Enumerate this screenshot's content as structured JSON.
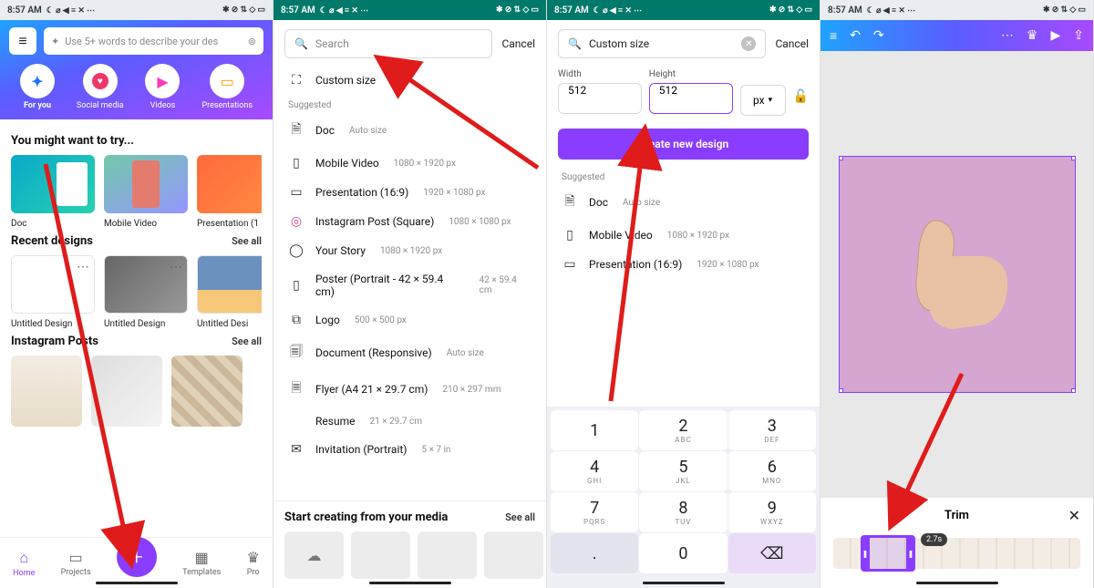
{
  "status": {
    "time": "8:57 AM",
    "icons_left": [
      "☾",
      "⌀",
      "◀",
      "≡",
      "✕",
      "⋯"
    ],
    "icons_right": [
      "✱",
      "⊘",
      "⇅",
      "◇",
      "▯68"
    ]
  },
  "screen1": {
    "search_placeholder": "Use 5+ words to describe your des",
    "cats": [
      {
        "label": "For you",
        "color": "c-star",
        "glyph": "✦"
      },
      {
        "label": "Social media",
        "color": "",
        "glyph": "♥"
      },
      {
        "label": "Videos",
        "color": "c-play",
        "glyph": "▶"
      },
      {
        "label": "Presentations",
        "color": "c-pres",
        "glyph": "▭"
      }
    ],
    "try_title": "You might want to try...",
    "try": [
      {
        "label": "Doc",
        "cls": "t-doc"
      },
      {
        "label": "Mobile Video",
        "cls": "t-mob"
      },
      {
        "label": "Presentation (1",
        "cls": "t-pres"
      }
    ],
    "recent_title": "Recent designs",
    "recent_seeall": "See all",
    "recent": [
      {
        "label": "Untitled Design",
        "cls": ""
      },
      {
        "label": "Untitled Design",
        "cls": "rock"
      },
      {
        "label": "Untitled Desi",
        "cls": "sun"
      }
    ],
    "ig_title": "Instagram Posts",
    "ig_seeall": "See all",
    "bottom": [
      {
        "label": "Home",
        "glyph": "⌂"
      },
      {
        "label": "Projects",
        "glyph": "▭"
      },
      {
        "label": "",
        "glyph": "+"
      },
      {
        "label": "Templates",
        "glyph": "▦"
      },
      {
        "label": "Pro",
        "glyph": "♛"
      }
    ]
  },
  "screen2": {
    "search_placeholder": "Search",
    "cancel": "Cancel",
    "custom_label": "Custom size",
    "suggested_label": "Suggested",
    "items": [
      {
        "glyph": "🗎",
        "label": "Doc",
        "sub": "Auto size"
      },
      {
        "glyph": "▭",
        "label": "Mobile Video",
        "sub": "1080 × 1920 px"
      },
      {
        "glyph": "▭",
        "label": "Presentation (16:9)",
        "sub": "1920 × 1080 px"
      },
      {
        "glyph": "◎",
        "label": "Instagram Post (Square)",
        "sub": "1080 × 1080 px"
      },
      {
        "glyph": "◯",
        "label": "Your Story",
        "sub": "1080 × 1920 px"
      },
      {
        "glyph": "▯",
        "label": "Poster (Portrait - 42 × 59.4 cm)",
        "sub": "42 × 59.4 cm"
      },
      {
        "glyph": "⧉",
        "label": "Logo",
        "sub": "500 × 500 px"
      },
      {
        "glyph": "🗐",
        "label": "Document (Responsive)",
        "sub": "Auto size"
      },
      {
        "glyph": "🗏",
        "label": "Flyer (A4 21 × 29.7 cm)",
        "sub": "210 × 297 mm"
      },
      {
        "glyph": "",
        "label": "Resume",
        "sub": "21 × 29.7 cm"
      },
      {
        "glyph": "✉",
        "label": "Invitation (Portrait)",
        "sub": "5 × 7 in"
      }
    ],
    "media_title": "Start creating from your media",
    "media_seeall": "See all"
  },
  "screen3": {
    "search_value": "Custom size",
    "cancel": "Cancel",
    "width_label": "Width",
    "height_label": "Height",
    "width_value": "512",
    "height_value": "512",
    "unit": "px",
    "create_label": "Create new design",
    "suggested_label": "Suggested",
    "items": [
      {
        "glyph": "🗎",
        "label": "Doc",
        "sub": "Auto size"
      },
      {
        "glyph": "▭",
        "label": "Mobile Video",
        "sub": "1080 × 1920 px"
      },
      {
        "glyph": "▭",
        "label": "Presentation (16:9)",
        "sub": "1920 × 1080 px"
      }
    ],
    "keys": [
      {
        "n": "1",
        "s": ""
      },
      {
        "n": "2",
        "s": "ABC"
      },
      {
        "n": "3",
        "s": "DEF"
      },
      {
        "n": "4",
        "s": "GHI"
      },
      {
        "n": "5",
        "s": "JKL"
      },
      {
        "n": "6",
        "s": "MNO"
      },
      {
        "n": "7",
        "s": "PQRS"
      },
      {
        "n": "8",
        "s": "TUV"
      },
      {
        "n": "9",
        "s": "WXYZ"
      },
      {
        "n": ".",
        "s": ""
      },
      {
        "n": "0",
        "s": ""
      },
      {
        "n": "⌫",
        "s": ""
      }
    ]
  },
  "screen4": {
    "trim_label": "Trim",
    "duration": "2.7s"
  }
}
